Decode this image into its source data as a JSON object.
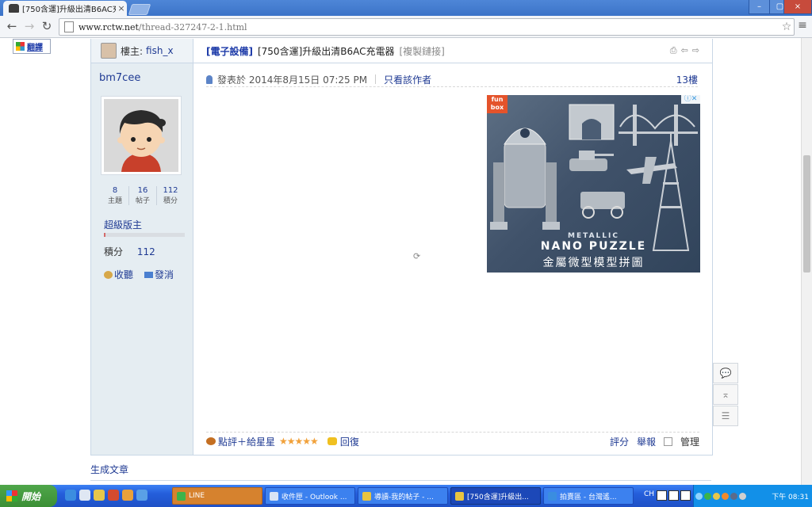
{
  "browser": {
    "tab_title": "[750含運]升級出清B6AC充",
    "tab_close": "×",
    "url_domain": "www.rctw.net",
    "url_path": "/thread-327247-2-1.html",
    "back": "←",
    "forward": "→",
    "reload": "↻",
    "star": "☆",
    "menu": "≡",
    "window_min": "–",
    "window_max": "▢",
    "window_close": "×"
  },
  "site": {
    "link_label": "翻譯"
  },
  "sidebar": {
    "moderator_prefix": "樓主:",
    "moderator_name": "fish_x",
    "author": "bm7cee",
    "stats": [
      {
        "num": "8",
        "label": "主題"
      },
      {
        "num": "16",
        "label": "帖子"
      },
      {
        "num": "112",
        "label": "積分"
      }
    ],
    "rank": "超級版主",
    "rank_progress": 0.02,
    "score_label": "積分",
    "score_value": "112",
    "actions": {
      "favorite": "收聽",
      "message": "發消"
    }
  },
  "thread": {
    "category": "[電子設備]",
    "title": "[750含運]升級出清B6AC充電器",
    "copy_link": "[複製鏈接]",
    "tools": [
      "⎙",
      "⇦",
      "⇨"
    ],
    "posted": "發表於 2014年8月15日 07:25 PM",
    "only_author": "只看該作者",
    "floor": "13樓"
  },
  "ad": {
    "brand": "fun box",
    "choice": "ⓘ✕",
    "line1": "METALLIC",
    "line2": "NANO PUZZLE",
    "line3": "金屬微型模型拼圖"
  },
  "spinner": "⟳",
  "footer": {
    "rate": "點評＋給星星",
    "stars": "★★★★★",
    "reply": "回復",
    "grade": "評分",
    "report": "舉報",
    "manage": "管理"
  },
  "generate": "生成文章",
  "side_tools": [
    "💬",
    "⌅",
    "☰"
  ],
  "taskbar": {
    "start": "開始",
    "tasks": [
      {
        "label": "LINE",
        "kind": "line",
        "color": "#3cb34a"
      },
      {
        "label": "收件匣 - Outlook ...",
        "kind": "normal",
        "color": "#d8e4f5"
      },
      {
        "label": "導讀-我的帖子 - ...",
        "kind": "normal",
        "color": "#e8c440"
      },
      {
        "label": "[750含運]升級出...",
        "kind": "active",
        "color": "#e8c440"
      },
      {
        "label": "拍賣區 - 台灣遙...",
        "kind": "normal",
        "color": "#3a8de0"
      }
    ],
    "lang": "CH",
    "clock": "下午 08:31"
  },
  "colors": {
    "link": "#1f3a93",
    "sidebar_bg": "#e5edf2",
    "border": "#c9d7e6",
    "taskbar": "#245edb"
  }
}
